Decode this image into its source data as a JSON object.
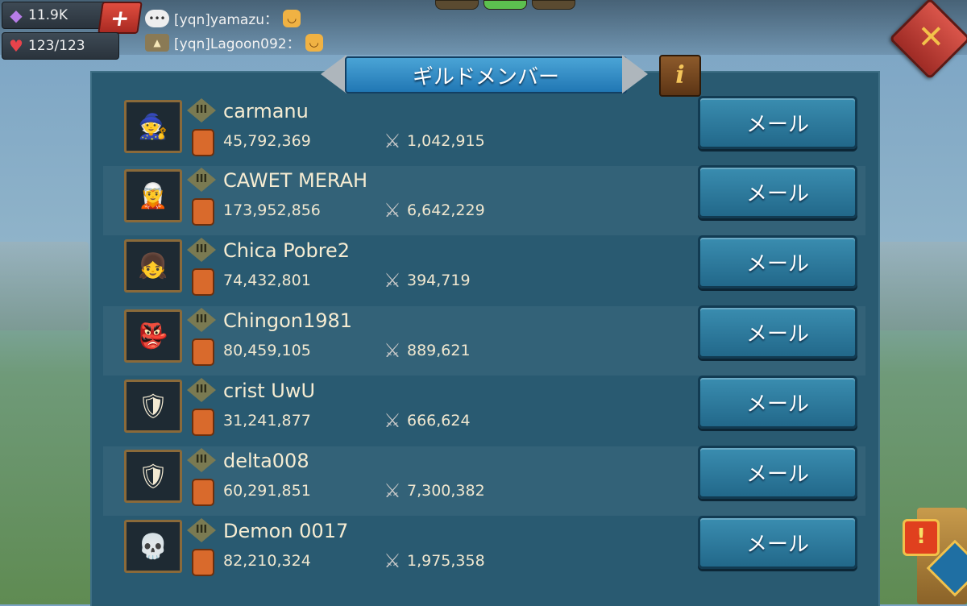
{
  "resources": {
    "gems": "11.9K",
    "stamina": "123/123",
    "add_label": "+"
  },
  "chat": [
    {
      "text": "[yqn]yamazu：",
      "icon": "speech-bubble-icon"
    },
    {
      "text": "[yqn]Lagoon092：",
      "icon": "guild-badge-icon"
    }
  ],
  "title": "ギルドメンバー",
  "info_label": "i",
  "close_label": "✕",
  "members": [
    {
      "name": "carmanu",
      "power": "45,792,369",
      "kills": "1,042,915",
      "rank": "III",
      "mail": "メール"
    },
    {
      "name": "CAWET MERAH",
      "power": "173,952,856",
      "kills": "6,642,229",
      "rank": "III",
      "mail": "メール"
    },
    {
      "name": "Chica Pobre2",
      "power": "74,432,801",
      "kills": "394,719",
      "rank": "III",
      "mail": "メール"
    },
    {
      "name": "Chingon1981",
      "power": "80,459,105",
      "kills": "889,621",
      "rank": "III",
      "mail": "メール"
    },
    {
      "name": "crist UwU",
      "power": "31,241,877",
      "kills": "666,624",
      "rank": "III",
      "mail": "メール"
    },
    {
      "name": "delta008",
      "power": "60,291,851",
      "kills": "7,300,382",
      "rank": "III",
      "mail": "メール"
    },
    {
      "name": "Demon 0017",
      "power": "82,210,324",
      "kills": "1,975,358",
      "rank": "III",
      "mail": "メール"
    }
  ],
  "colors": {
    "panel": "#295a71",
    "button": "#2e7ea1",
    "close": "#c9473d",
    "title": "#2f8cc7"
  }
}
